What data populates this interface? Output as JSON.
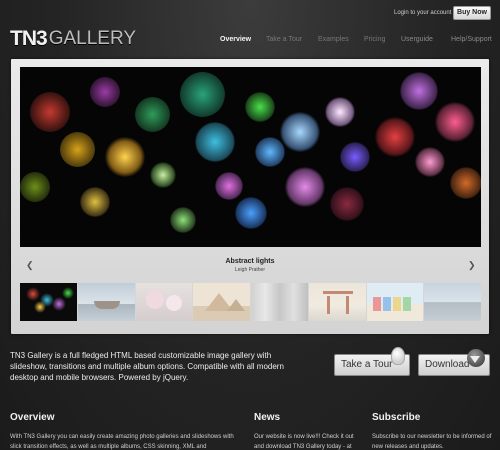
{
  "topbar": {
    "login_text": "Login to your account or",
    "buy_label": "Buy Now"
  },
  "logo": {
    "tn3": "TN3",
    "gallery": "GALLERY"
  },
  "nav": {
    "items": [
      {
        "label": "Overview"
      },
      {
        "label": "Take a Tour"
      },
      {
        "label": "Examples"
      },
      {
        "label": "Pricing"
      },
      {
        "label": "Userguide"
      },
      {
        "label": "Help/Support"
      }
    ]
  },
  "gallery": {
    "caption_title": "Abstract lights",
    "caption_sub": "Leigh Prather",
    "prev_icon": "chevron-left-icon",
    "next_icon": "chevron-right-icon",
    "thumb_count": 8
  },
  "description": "TN3 Gallery is a full fledged HTML based customizable image gallery with slideshow, transitions and multiple album options. Compatible with all modern desktop and mobile browsers. Powered by jQuery.",
  "cta": {
    "tour_label": "Take a Tour",
    "download_label": "Download",
    "tour_icon": "lightbulb-icon",
    "download_icon": "download-arrow-icon"
  },
  "footer": {
    "overview_title": "Overview",
    "overview_text": "With TN3 Gallery you can easily create amazing photo galleries and slideshows with slick transition effects, as well as multiple albums, CSS skinning, XML and",
    "news_title": "News",
    "news_text": "Our website is now live!!! Check it out and download TN3 Gallery today - at",
    "subscribe_title": "Subscribe",
    "subscribe_text": "Subscribe to our newsletter to be informed of new releases and updates."
  },
  "colors": {
    "background": "#242424",
    "panel": "#e0e0e0",
    "accent_text": "#f4f4f4"
  }
}
